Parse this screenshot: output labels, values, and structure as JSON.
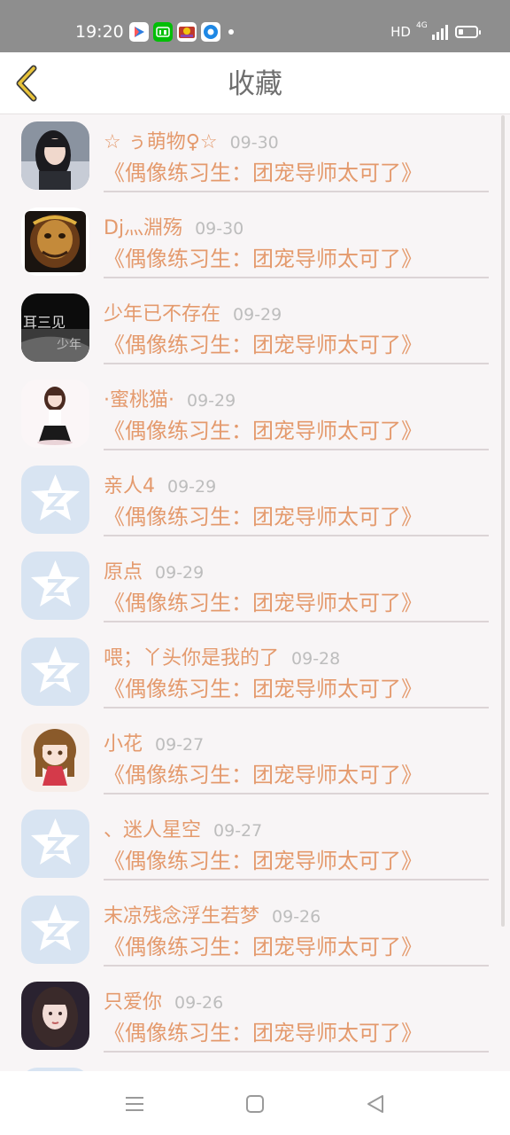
{
  "status_bar": {
    "time": "19:20",
    "network_label": "HD",
    "network_type": "4G",
    "app_icons": [
      "video-app-icon",
      "iqiyi-app-icon",
      "game-app-icon",
      "browser-app-icon"
    ]
  },
  "header": {
    "title": "收藏"
  },
  "items": [
    {
      "name": "☆ ぅ萌物♀☆",
      "date": "09-30",
      "book": "《偶像练习生：团宠导师太可了》",
      "avatar": "photo-girl"
    },
    {
      "name": "Dj灬淵殇",
      "date": "09-30",
      "book": "《偶像练习生：团宠导师太可了》",
      "avatar": "photo-monkey-king"
    },
    {
      "name": "少年已不存在",
      "date": "09-29",
      "book": "《偶像练习生：团宠导师太可了》",
      "avatar": "photo-dark-text"
    },
    {
      "name": "·蜜桃猫·",
      "date": "09-29",
      "book": "《偶像练习生：团宠导师太可了》",
      "avatar": "photo-anime-girl"
    },
    {
      "name": "亲人4",
      "date": "09-29",
      "book": "《偶像练习生：团宠导师太可了》",
      "avatar": "default-star"
    },
    {
      "name": "原点",
      "date": "09-29",
      "book": "《偶像练习生：团宠导师太可了》",
      "avatar": "default-star"
    },
    {
      "name": "喂；丫头你是我的了",
      "date": "09-28",
      "book": "《偶像练习生：团宠导师太可了》",
      "avatar": "default-star"
    },
    {
      "name": "小花",
      "date": "09-27",
      "book": "《偶像练习生：团宠导师太可了》",
      "avatar": "photo-cartoon-girl"
    },
    {
      "name": "、迷人星空",
      "date": "09-27",
      "book": "《偶像练习生：团宠导师太可了》",
      "avatar": "default-star"
    },
    {
      "name": "末凉残念浮生若梦",
      "date": "09-26",
      "book": "《偶像练习生：团宠导师太可了》",
      "avatar": "default-star"
    },
    {
      "name": "只爱你",
      "date": "09-26",
      "book": "《偶像练习生：团宠导师太可了》",
      "avatar": "photo-girl-2"
    },
    {
      "name": "",
      "date": "",
      "book": "",
      "avatar": "default-star"
    }
  ],
  "colors": {
    "accent": "#e49a6d",
    "date": "#bdbdbd",
    "back_arrow": "#e8c33a",
    "default_avatar_bg": "#d8e4f2"
  },
  "nav": [
    "menu-icon",
    "home-icon",
    "back-icon"
  ]
}
